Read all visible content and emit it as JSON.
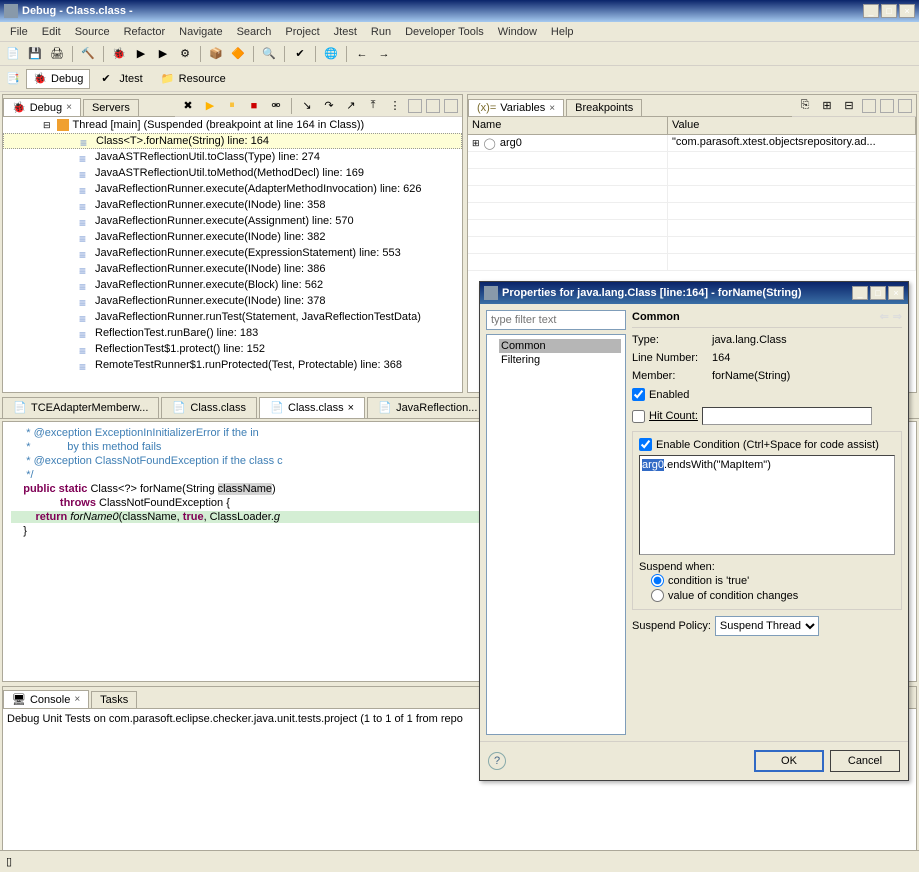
{
  "window": {
    "title": "Debug - Class.class -"
  },
  "menus": [
    "File",
    "Edit",
    "Source",
    "Refactor",
    "Navigate",
    "Search",
    "Project",
    "Jtest",
    "Run",
    "Developer Tools",
    "Window",
    "Help"
  ],
  "perspectives": [
    {
      "label": "Debug",
      "active": true
    },
    {
      "label": "Jtest",
      "active": false
    },
    {
      "label": "Resource",
      "active": false
    }
  ],
  "debugView": {
    "tabs": [
      "Debug",
      "Servers"
    ],
    "thread": "Thread [main] (Suspended (breakpoint at line 164 in Class))",
    "frames": [
      "Class<T>.forName(String) line: 164",
      "JavaASTReflectionUtil.toClass(Type) line: 274",
      "JavaASTReflectionUtil.toMethod(MethodDecl) line: 169",
      "JavaReflectionRunner.execute(AdapterMethodInvocation) line: 626",
      "JavaReflectionRunner.execute(INode) line: 358",
      "JavaReflectionRunner.execute(Assignment) line: 570",
      "JavaReflectionRunner.execute(INode) line: 382",
      "JavaReflectionRunner.execute(ExpressionStatement) line: 553",
      "JavaReflectionRunner.execute(INode) line: 386",
      "JavaReflectionRunner.execute(Block) line: 562",
      "JavaReflectionRunner.execute(INode) line: 378",
      "JavaReflectionRunner.runTest(Statement, JavaReflectionTestData)",
      "ReflectionTest.runBare() line: 183",
      "ReflectionTest$1.protect() line: 152",
      "RemoteTestRunner$1.runProtected(Test, Protectable) line: 368"
    ],
    "selectedFrame": 0
  },
  "variables": {
    "tabs": [
      "Variables",
      "Breakpoints"
    ],
    "columns": [
      "Name",
      "Value"
    ],
    "rows": [
      {
        "name": "arg0",
        "value": "\"com.parasoft.xtest.objectsrepository.ad..."
      }
    ]
  },
  "editor": {
    "tabs": [
      {
        "label": "TCEAdapterMemberw...",
        "active": false
      },
      {
        "label": "Class.class",
        "active": false
      },
      {
        "label": "Class.class",
        "active": true,
        "close": true
      },
      {
        "label": "JavaReflection...",
        "active": false
      }
    ],
    "lines": {
      "c1": "     * @exception ExceptionInInitializerError if the in",
      "c2": "     *            by this method fails",
      "c3": "     * @exception ClassNotFoundException if the class c",
      "c4": "     */",
      "sig1": "    public static Class<?> forName(String ",
      "sig1b": "className",
      "sig1c": ")",
      "sig2": "                throws ClassNotFoundException {",
      "ret": "        return forName0(className, true, ClassLoader.g",
      "close": "    }"
    }
  },
  "console": {
    "tabs": [
      "Console",
      "Tasks"
    ],
    "text": "Debug Unit Tests on com.parasoft.eclipse.checker.java.unit.tests.project (1 to 1 of 1 from repo"
  },
  "dialog": {
    "title": "Properties for java.lang.Class [line:164] - forName(String)",
    "filter_placeholder": "type filter text",
    "tree": [
      "Common",
      "Filtering"
    ],
    "tree_selected": 0,
    "heading": "Common",
    "type_label": "Type:",
    "type_value": "java.lang.Class",
    "line_label": "Line Number:",
    "line_value": "164",
    "member_label": "Member:",
    "member_value": "forName(String)",
    "enabled_label": "Enabled",
    "enabled_checked": true,
    "hitcount_label": "Hit Count:",
    "hitcount_checked": false,
    "cond_enable_label": "Enable Condition (Ctrl+Space for code assist)",
    "cond_enable_checked": true,
    "cond_sel": "arg0",
    "cond_rest": ".endsWith(\"MapItem\")",
    "suspend_when": "Suspend when:",
    "radio_true": "condition is 'true'",
    "radio_change": "value of condition changes",
    "radio_selected": "true",
    "suspend_policy_label": "Suspend Policy:",
    "suspend_policy_value": "Suspend Thread",
    "ok": "OK",
    "cancel": "Cancel"
  }
}
